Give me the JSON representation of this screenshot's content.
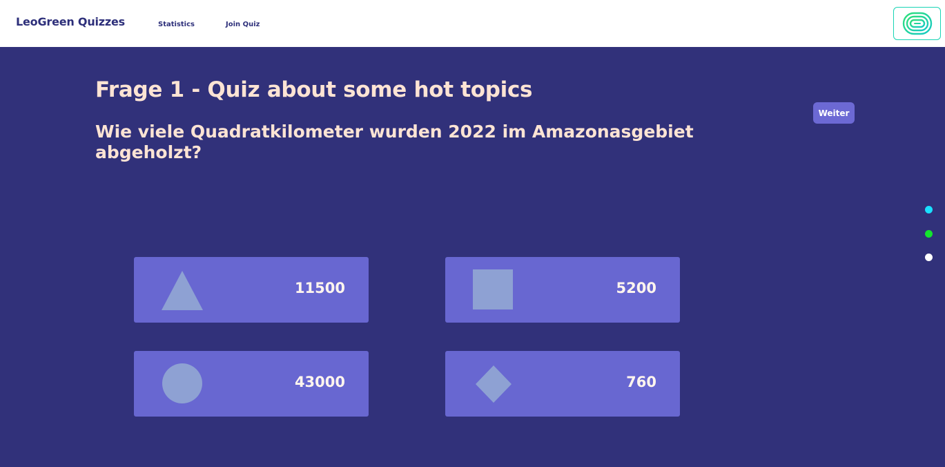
{
  "nav": {
    "brand": "LeoGreen Quizzes",
    "links": [
      "Statistics",
      "Join Quiz"
    ],
    "logo_icon": "concentric-rounded-loops-logo"
  },
  "quiz": {
    "title": "Frage 1 - Quiz about some hot topics",
    "question": "Wie viele Quadratkilometer wurden 2022 im Amazonasgebiet abgeholzt?",
    "next_label": "Weiter"
  },
  "answers": [
    {
      "shape": "triangle-icon",
      "value": "11500"
    },
    {
      "shape": "square-icon",
      "value": "5200"
    },
    {
      "shape": "circle-icon",
      "value": "43000"
    },
    {
      "shape": "diamond-icon",
      "value": "760"
    }
  ],
  "progress_dots": [
    "#19e0ff",
    "#13e52d",
    "#ffffff"
  ],
  "colors": {
    "background": "#31317a",
    "answer_card": "#6867d1",
    "shape_fill": "#8ea1d3",
    "title_text": "#fde4d4",
    "accent": "#18d4b4"
  }
}
